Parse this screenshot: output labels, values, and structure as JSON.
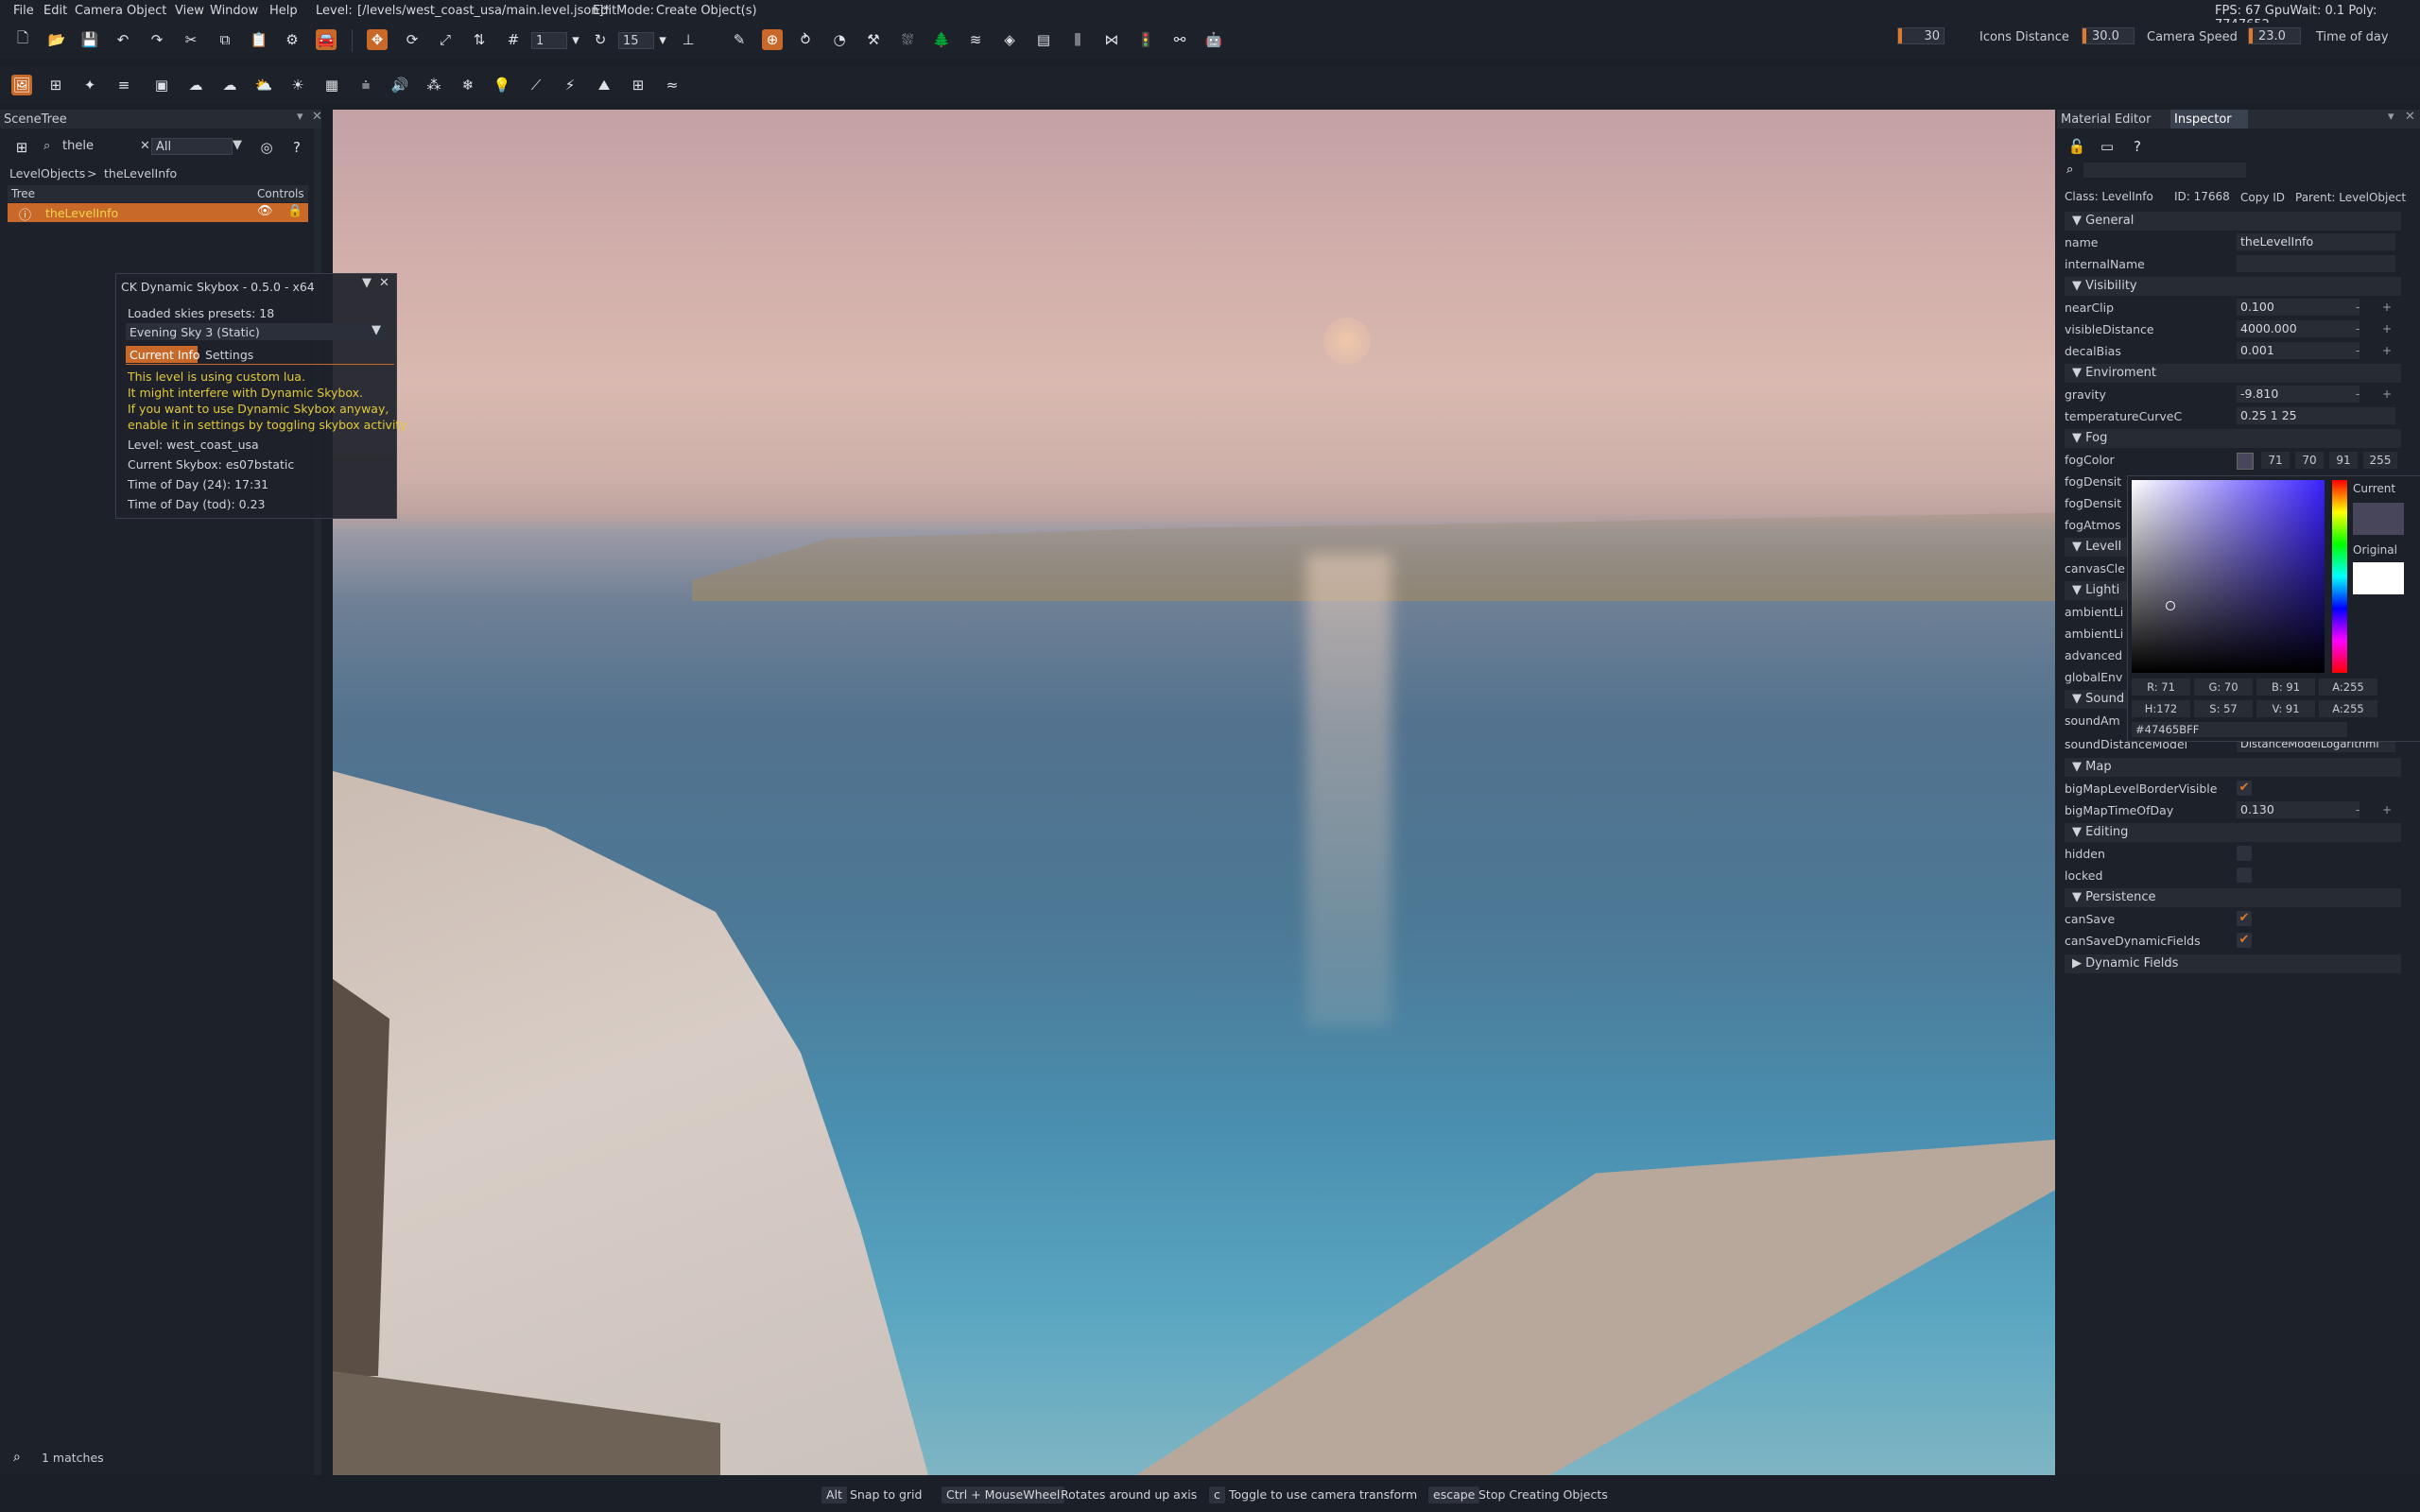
{
  "menubar": {
    "items": [
      "File",
      "Edit",
      "Camera",
      "Object",
      "View",
      "Window",
      "Help"
    ],
    "level_label": "Level:",
    "level_path": "[/levels/west_coast_usa/main.level.json]*",
    "editmode_label": "EditMode:",
    "editmode_value": "Create Object(s)",
    "stats": "FPS: 67  GpuWait: 0.1  Poly: 7747652"
  },
  "toolbar": {
    "grid_value": "1",
    "rot_value": "15",
    "icons_distance_value": "30",
    "icons_distance_label": "Icons Distance",
    "camera_speed_value": "30.0",
    "camera_speed_label": "Camera Speed",
    "time_of_day_value": "23.0",
    "time_of_day_label": "Time of day"
  },
  "scenetree": {
    "title": "SceneTree",
    "search_value": "thele",
    "filter_value": "All",
    "breadcrumb_root": "LevelObjects",
    "breadcrumb_sep": ">",
    "breadcrumb_leaf": "theLevelInfo",
    "col_tree": "Tree",
    "col_controls": "Controls",
    "item_label": "theLevelInfo",
    "matches": "1 matches"
  },
  "skybox": {
    "title": "CK Dynamic Skybox - 0.5.0 - x64",
    "loaded_presets": "Loaded skies presets:   18",
    "preset_selected": "Evening Sky 3 (Static)",
    "tab_current": "Current Info",
    "tab_settings": "Settings",
    "warn1": "This level is using custom lua.",
    "warn2": "It might interfere with Dynamic Skybox.",
    "warn3": "If you want to use Dynamic Skybox anyway,",
    "warn4": "enable it in settings by toggling skybox activity",
    "level": "Level:    west_coast_usa",
    "current_skybox": "Current Skybox:    es07bstatic",
    "tod24": "Time of Day (24):    17:31",
    "tod": "Time of Day (tod):    0.23"
  },
  "inspector": {
    "tab_material": "Material Editor",
    "tab_inspector": "Inspector",
    "class_label": "Class:  LevelInfo",
    "id_label": "ID:  17668",
    "copy_id": "Copy ID",
    "parent_label": "Parent:  LevelObject",
    "sections": {
      "general": "General",
      "visibility": "Visibility",
      "enviroment": "Enviroment",
      "fog": "Fog",
      "level": "LevelI",
      "lighting": "Lighti",
      "sound": "Sound",
      "map": "Map",
      "editing": "Editing",
      "persistence": "Persistence",
      "dynamic": "Dynamic Fields"
    },
    "fields": {
      "name": "name",
      "name_val": "theLevelInfo",
      "internalName": "internalName",
      "nearClip": "nearClip",
      "nearClip_val": "0.100",
      "visibleDistance": "visibleDistance",
      "visibleDistance_val": "4000.000",
      "decalBias": "decalBias",
      "decalBias_val": "0.001",
      "gravity": "gravity",
      "gravity_val": "-9.810",
      "temperatureCurveC": "temperatureCurveC",
      "temperatureCurveC_val": "0.25 1 25",
      "fogColor": "fogColor",
      "fog_r": "71",
      "fog_g": "70",
      "fog_b": "91",
      "fog_a": "255",
      "fogDensit1": "fogDensit",
      "fogDensit2": "fogDensit",
      "fogAtmos": "fogAtmos",
      "canvasCle": "canvasCle",
      "ambientLi1": "ambientLi",
      "ambientLi2": "ambientLi",
      "advanced": "advanced",
      "globalEnv": "globalEnv",
      "soundAm": "soundAm",
      "soundDistanceModel": "soundDistanceModel",
      "soundDistanceModel_val": "DistanceModelLogarithmi",
      "bigMapLevelBorderVisible": "bigMapLevelBorderVisible",
      "bigMapTimeOfDay": "bigMapTimeOfDay",
      "bigMapTimeOfDay_val": "0.130",
      "hidden": "hidden",
      "locked": "locked",
      "canSave": "canSave",
      "canSaveDynamicFields": "canSaveDynamicFields"
    },
    "minus": "-",
    "plus": "+"
  },
  "colorpicker": {
    "current_label": "Current",
    "original_label": "Original",
    "r": "R: 71",
    "g": "G: 70",
    "b": "B: 91",
    "a": "A:255",
    "h": "H:172",
    "s": "S: 57",
    "v": "V: 91",
    "a2": "A:255",
    "hex": "#47465BFF"
  },
  "statusbar": {
    "k1": "Alt",
    "d1": "Snap to grid",
    "k2": "Ctrl + MouseWheel",
    "d2": "Rotates around up axis",
    "k3": "c",
    "d3": "Toggle to use camera transform",
    "k4": "escape",
    "d4": "Stop Creating Objects"
  },
  "colors": {
    "accent": "#e07a2b",
    "panel": "#1d2129",
    "warning": "#e2c93a"
  }
}
